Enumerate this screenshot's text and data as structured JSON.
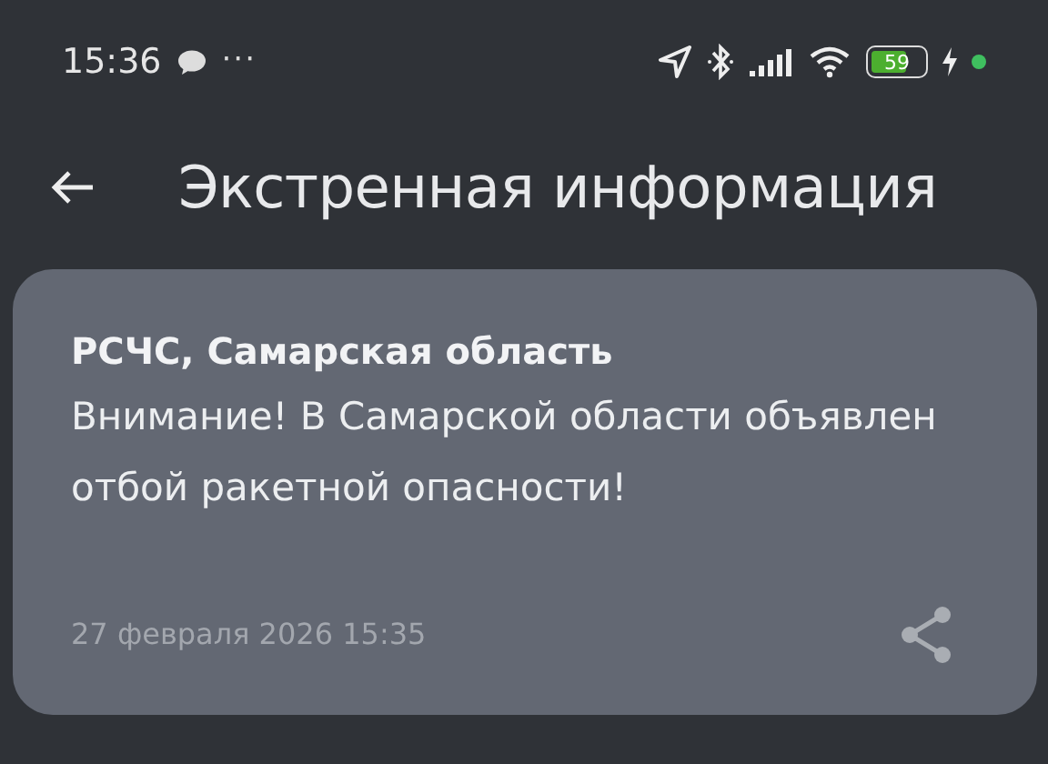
{
  "status_bar": {
    "time": "15:36",
    "more": "···",
    "battery": "59"
  },
  "header": {
    "title": "Экстренная информация"
  },
  "messages": [
    {
      "sender": "РСЧС, Самарская область",
      "text": "Внимание! В Самарской области объявлен отбой ракетной опасности!",
      "date": "27 февраля 2026 15:35"
    }
  ]
}
